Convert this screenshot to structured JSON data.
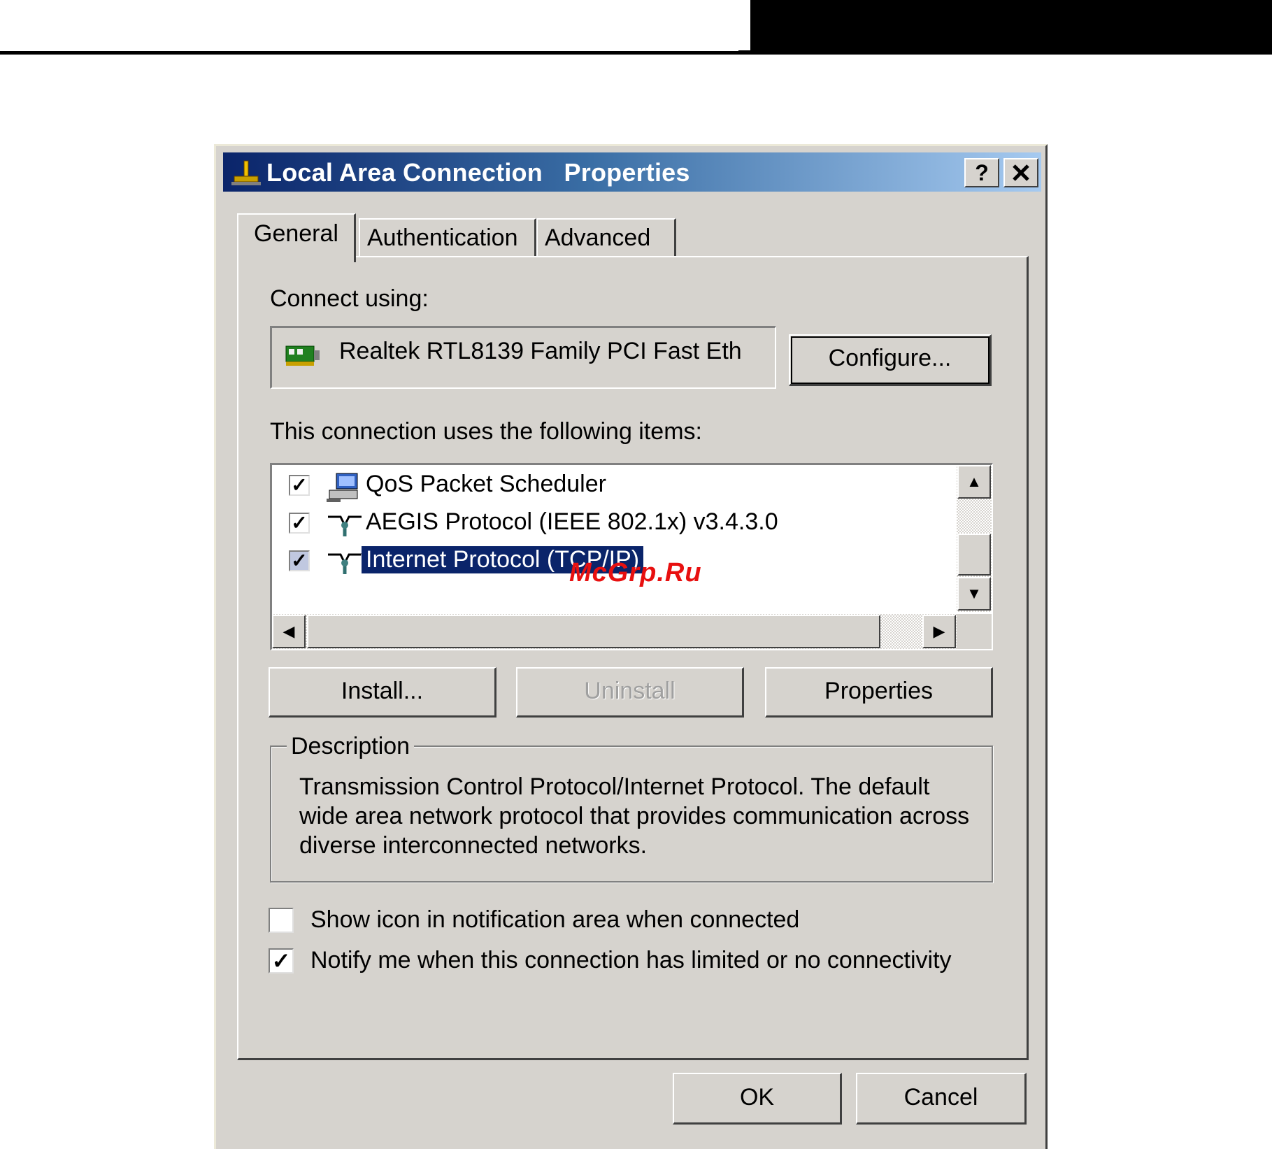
{
  "window": {
    "title_part1": "Local Area Connection",
    "title_part2": "Properties",
    "help_label": "?",
    "close_label": "✕"
  },
  "tabs": [
    {
      "label": "General",
      "active": true
    },
    {
      "label": "Authentication",
      "active": false
    },
    {
      "label": "Advanced",
      "active": false
    }
  ],
  "connect_using": {
    "label": "Connect using:",
    "adapter": "Realtek RTL8139 Family PCI Fast Eth",
    "configure_label": "Configure..."
  },
  "items_section": {
    "label": "This connection uses the following items:",
    "items": [
      {
        "label": "QoS Packet Scheduler",
        "checked": true,
        "icon": "scheduler-icon",
        "selected": false
      },
      {
        "label": "AEGIS Protocol (IEEE 802.1x) v3.4.3.0",
        "checked": true,
        "icon": "protocol-icon",
        "selected": false
      },
      {
        "label": "Internet Protocol (TCP/IP)",
        "checked": true,
        "icon": "protocol-icon",
        "selected": true
      }
    ]
  },
  "buttons": {
    "install": "Install...",
    "uninstall": "Uninstall",
    "properties": "Properties",
    "ok": "OK",
    "cancel": "Cancel"
  },
  "description": {
    "title": "Description",
    "text": "Transmission Control Protocol/Internet Protocol. The default wide area network protocol that provides communication across diverse interconnected networks."
  },
  "options": [
    {
      "label": "Show icon in notification area when connected",
      "checked": false
    },
    {
      "label": "Notify me when this connection has limited or no connectivity",
      "checked": true
    }
  ],
  "watermark": "McGrp.Ru",
  "colors": {
    "title_start": "#0a246a",
    "title_end": "#a6caf0",
    "dialog_bg": "#d6d3ce",
    "selection": "#0a246a",
    "watermark": "#e81010"
  }
}
